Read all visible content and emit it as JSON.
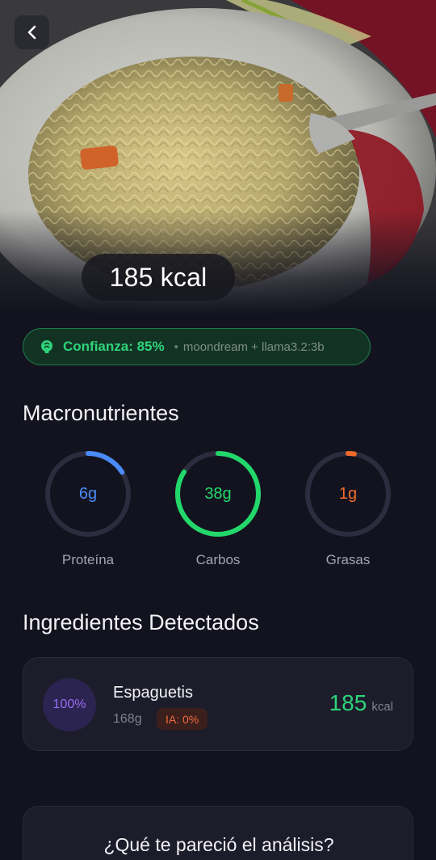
{
  "hero": {
    "kcal_label": "185 kcal",
    "back_icon": "chevron-left-icon"
  },
  "confidence": {
    "icon": "brain-icon",
    "label": "Confianza: 85%",
    "value_percent": 85,
    "separator": "•",
    "model": "moondream + llama3.2:3b",
    "color": "#2fd37a"
  },
  "macros": {
    "title": "Macronutrientes",
    "items": [
      {
        "value": "6g",
        "label": "Proteína",
        "color": "#4a8cf7",
        "fraction": 0.16
      },
      {
        "value": "38g",
        "label": "Carbos",
        "color": "#22d86b",
        "fraction": 0.84
      },
      {
        "value": "1g",
        "label": "Grasas",
        "color": "#f26a2a",
        "fraction": 0.02
      }
    ]
  },
  "ingredients": {
    "title": "Ingredientes Detectados",
    "items": [
      {
        "percent": "100%",
        "name": "Espaguetis",
        "weight": "168g",
        "ia_badge": "IA: 0%",
        "kcal_value": "185",
        "kcal_unit": "kcal"
      }
    ]
  },
  "feedback": {
    "title": "¿Qué te pareció el análisis?"
  },
  "colors": {
    "background": "#13131f",
    "card": "#1c1c2b",
    "accent_green": "#2fd37a",
    "protein_blue": "#4a8cf7",
    "fat_orange": "#f26a2a"
  }
}
